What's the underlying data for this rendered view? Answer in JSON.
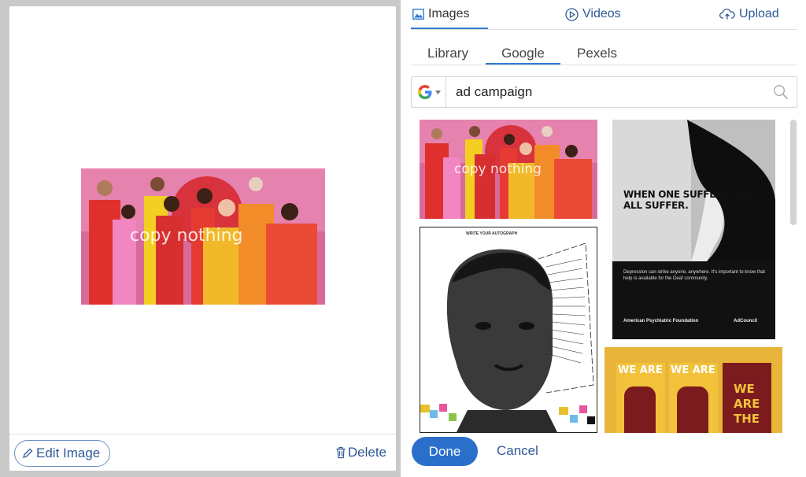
{
  "left": {
    "preview_caption": "copy nothing",
    "edit_label": "Edit Image",
    "delete_label": "Delete"
  },
  "media_tabs": [
    {
      "label": "Images",
      "icon": "image-icon",
      "active": true
    },
    {
      "label": "Videos",
      "icon": "play-circle-icon",
      "active": false
    },
    {
      "label": "Upload",
      "icon": "cloud-upload-icon",
      "active": false
    }
  ],
  "source_tabs": [
    {
      "label": "Library",
      "active": false
    },
    {
      "label": "Google",
      "active": true
    },
    {
      "label": "Pexels",
      "active": false
    }
  ],
  "search": {
    "engine": "google-icon",
    "query": "ad campaign"
  },
  "results": {
    "copy_nothing": {
      "caption": "copy nothing"
    },
    "when_one_suffers": {
      "headline": "WHEN ONE SUFFERS, WE ALL SUFFER.",
      "body": "Depression can strike anyone, anywhere. It's important to know that help is available for the Deaf community.",
      "logo_left": "American Psychiatric Foundation",
      "logo_right": "AdCouncil"
    },
    "write_your_autograph": {
      "header": "WRITE YOUR AUTOGRAPH"
    },
    "we_are": {
      "tile1": "WE ARE",
      "tile2": "WE ARE",
      "tile3": [
        "WE",
        "ARE",
        "THE"
      ]
    }
  },
  "actions": {
    "done_label": "Done",
    "cancel_label": "Cancel"
  },
  "colors": {
    "accent": "#2a6fc9",
    "link": "#2f5a96",
    "underline": "#2f7bd0"
  }
}
